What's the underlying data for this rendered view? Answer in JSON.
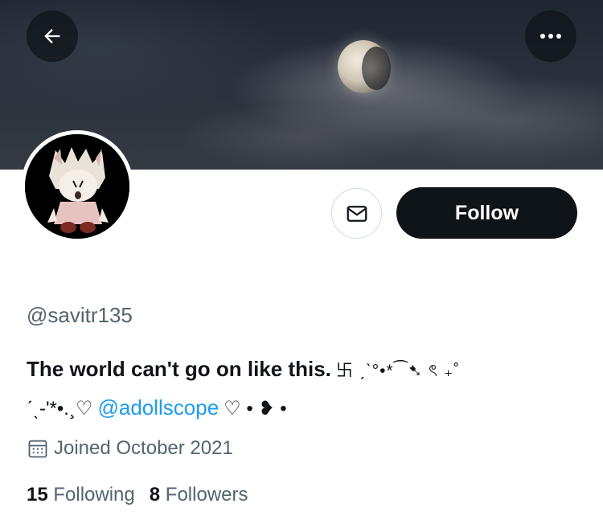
{
  "header": {
    "back_icon": "arrow-left-icon",
    "more_icon": "more-horizontal-icon"
  },
  "profile": {
    "handle": "@savitr135",
    "bio": {
      "text": "The world can't go on like this.",
      "deco_1": "卐 ˏˋ°•*⁀➷ ৎ ₊˚",
      "deco_2_prefix": "ˊˎ-'*•.¸♡",
      "mention": "@adollscope",
      "deco_2_suffix": "♡ • ❥ •"
    },
    "joined": "Joined October 2021",
    "stats": {
      "following_count": "15",
      "following_label": "Following",
      "followers_count": "8",
      "followers_label": "Followers"
    }
  },
  "actions": {
    "message_icon": "mail-icon",
    "follow_label": "Follow"
  },
  "colors": {
    "accent": "#1d9bf0",
    "text_primary": "#0f1419",
    "text_secondary": "#536471",
    "button_dark": "#0f1419"
  }
}
